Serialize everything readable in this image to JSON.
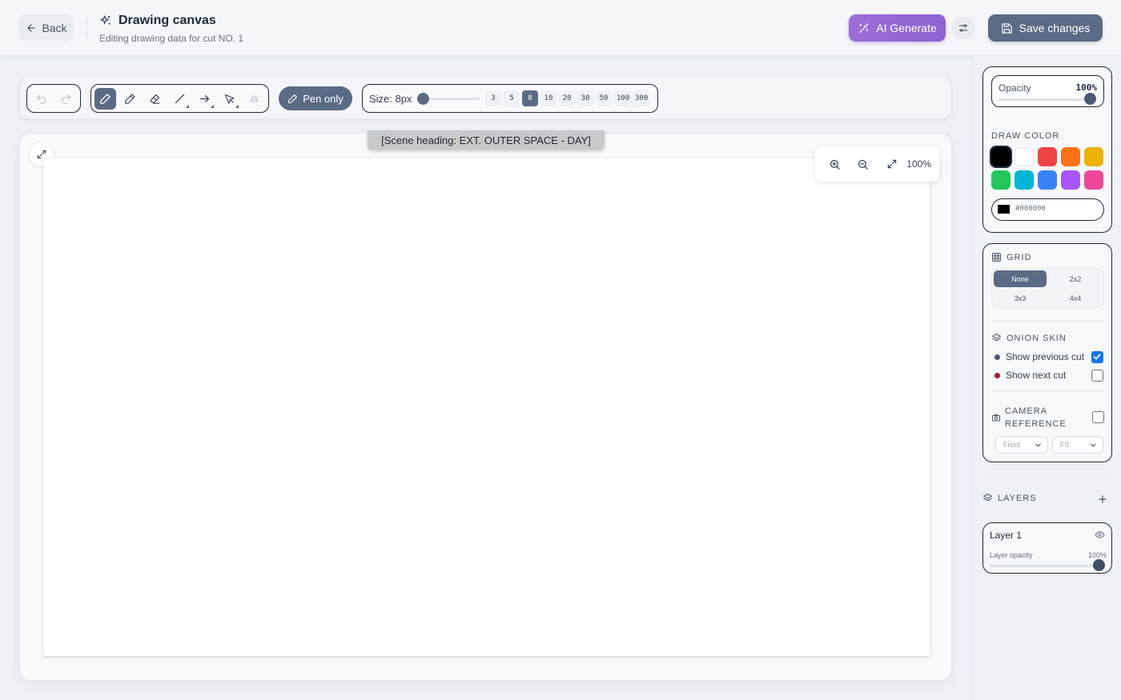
{
  "header": {
    "back_label": "Back",
    "title": "Drawing canvas",
    "subtitle": "Editing drawing data for cut NO. 1",
    "ai_label": "AI Generate",
    "save_label": "Save changes"
  },
  "toolbar": {
    "pen_only_label": "Pen only",
    "size_label": "Size: 8px",
    "size_value": 8,
    "size_presets": [
      "3",
      "5",
      "8",
      "10",
      "20",
      "30",
      "50",
      "100",
      "300"
    ],
    "active_size": "8"
  },
  "canvas": {
    "scene_heading": "[Scene heading: EXT. OUTER SPACE - DAY]",
    "zoom_label": "100%"
  },
  "panel": {
    "opacity_label": "Opacity",
    "opacity_value": "100%",
    "draw_color_label": "DRAW COLOR",
    "colors": [
      "#000000",
      "#ffffff",
      "#ef4444",
      "#f97316",
      "#eab308",
      "#22c55e",
      "#06b6d4",
      "#3b82f6",
      "#a855f7",
      "#ec4899"
    ],
    "hex_value": "#000000",
    "grid_label": "GRID",
    "grid_options": [
      "None",
      "2x2",
      "3x3",
      "4x4"
    ],
    "grid_active": "None",
    "onion_label": "ONION SKIN",
    "show_prev_label": "Show previous cut",
    "show_next_label": "Show next cut",
    "prev_dot_color": "#4b5a73",
    "next_dot_color": "#9b2335",
    "camera_label_1": "CAMERA",
    "camera_label_2": "REFERENCE",
    "camera_view": "Front",
    "camera_shot": "FS",
    "layers_label": "LAYERS",
    "layer_name": "Layer 1",
    "layer_opacity_label": "Layer opacity",
    "layer_opacity_value": "100%"
  },
  "colors": {
    "accent": "#5b6b85",
    "ai": "#9b6fd6",
    "checkbox": "#1a73e8"
  }
}
